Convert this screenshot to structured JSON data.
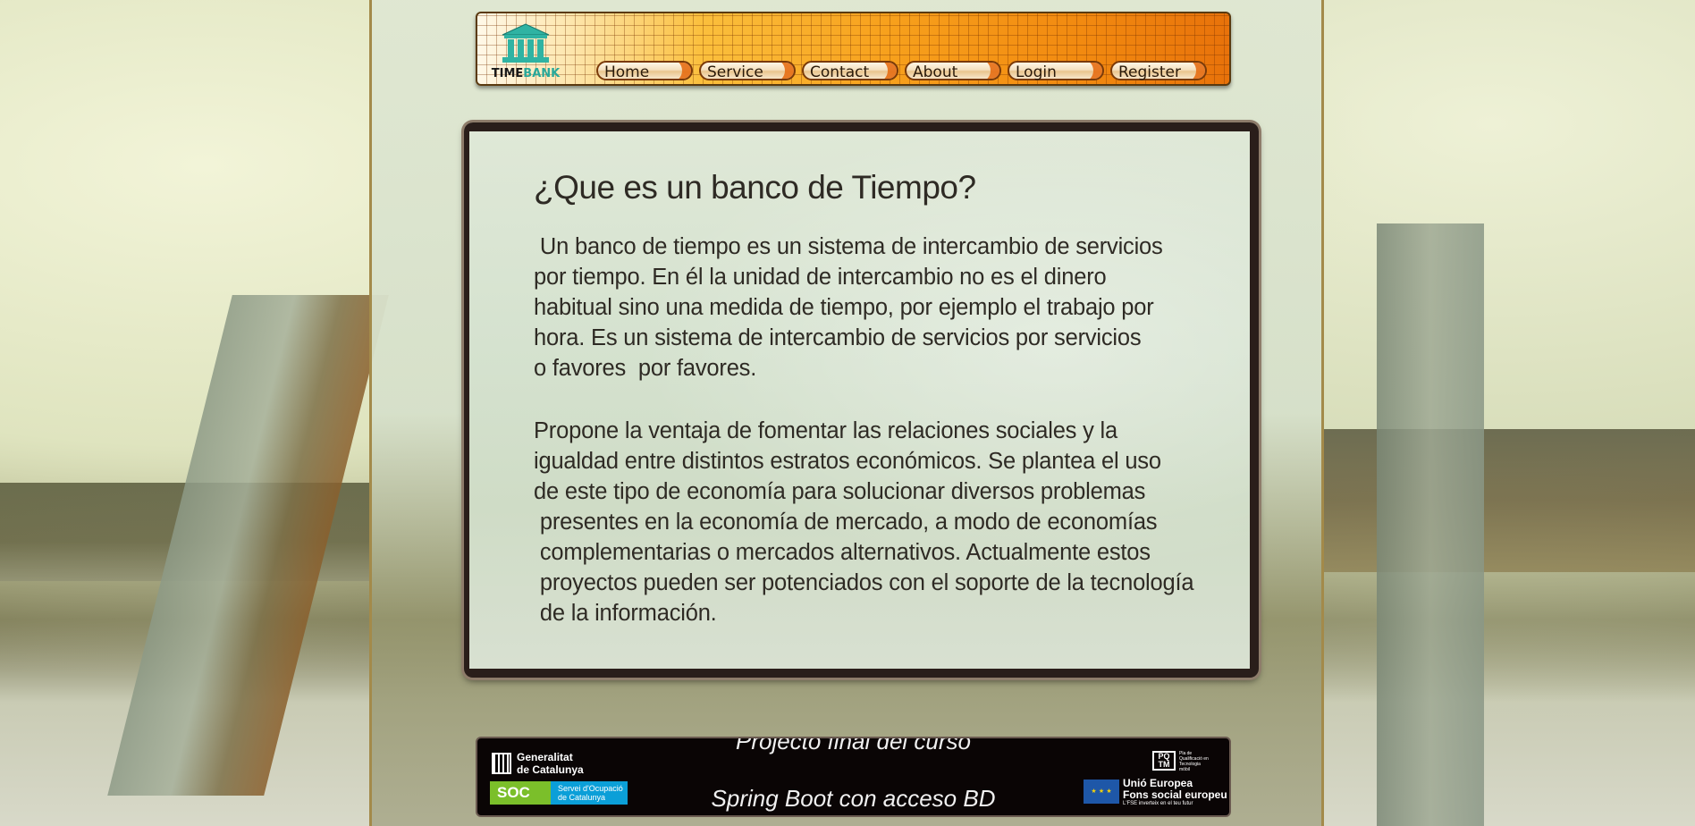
{
  "header": {
    "logo": {
      "time": "TIME",
      "bank": "BANK"
    },
    "nav": [
      {
        "label": "Home"
      },
      {
        "label": "Service"
      },
      {
        "label": "Contact"
      },
      {
        "label": "About"
      },
      {
        "label": "Login"
      },
      {
        "label": "Register"
      }
    ]
  },
  "main": {
    "title": "¿Que es un banco de Tiempo?",
    "paragraph1": " Un banco de tiempo es un sistema de intercambio de servicios\npor tiempo. En él la unidad de intercambio no es el dinero\nhabitual sino una medida de tiempo, por ejemplo el trabajo por\nhora. Es un sistema de intercambio de servicios por servicios\no favores  por favores.",
    "paragraph2": "Propone la ventaja de fomentar las relaciones sociales y la\nigualdad entre distintos estratos económicos. Se plantea el uso\nde este tipo de economía para solucionar diversos problemas\n presentes en la economía de mercado, a modo de economías\n complementarias o mercados alternativos. Actualmente estos\n proyectos pueden ser potenciados con el soporte de la tecnología\n de la información."
  },
  "footer": {
    "line1": "Projecto final del curso",
    "line2": "Spring Boot con acceso BD",
    "generalitat": "Generalitat\nde Catalunya",
    "soc": "SOC",
    "soc_sub": "Servei d'Ocupació\nde Catalunya",
    "pqtm": "PQ\nTM",
    "pqtm_sub": "Pla de\nQualificació en\nTecnologia\nmòbil",
    "eu": "Unió Europea\nFons social europeu",
    "eu_small": "L'FSE inverteix en el teu futur",
    "colors": {
      "soc_green": "#7bbf2a",
      "soc_blue": "#0b9fd8",
      "eu_blue": "#1e57a8"
    }
  }
}
